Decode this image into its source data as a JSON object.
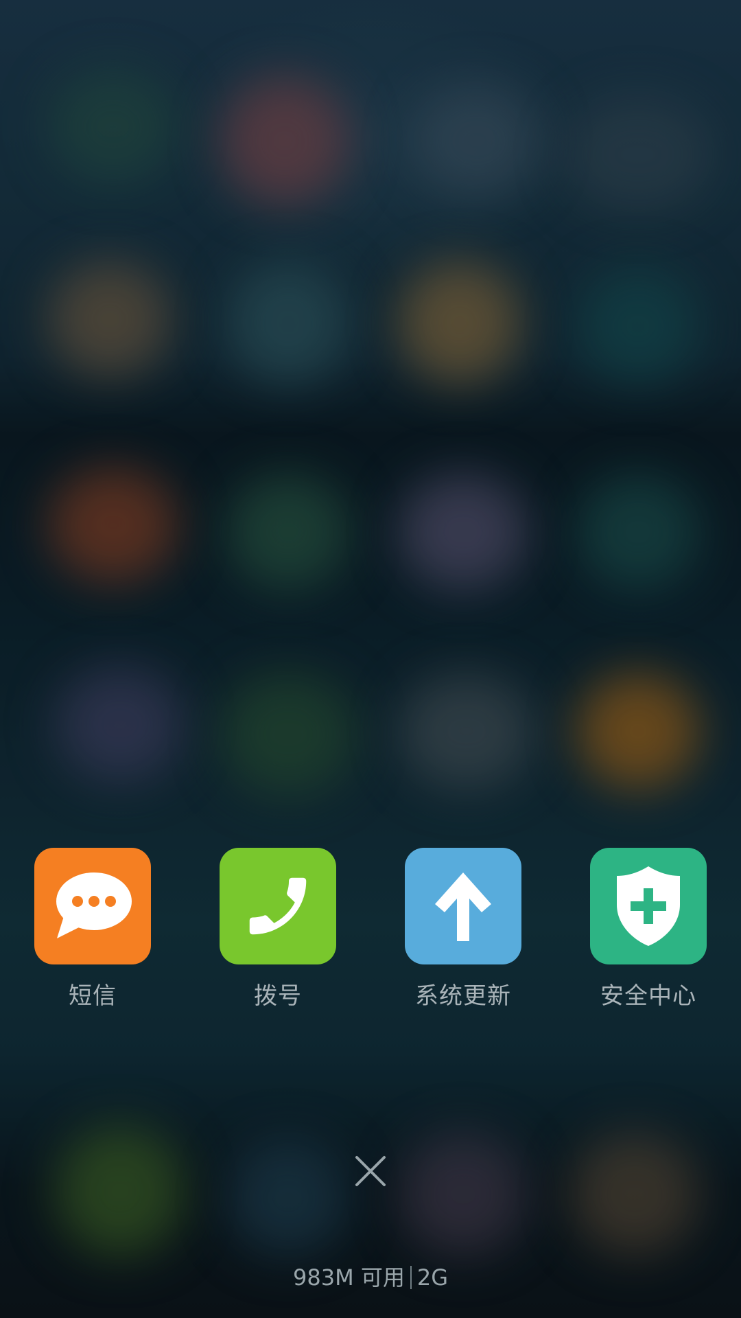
{
  "apps": [
    {
      "label": "短信",
      "icon": "message-bubble-icon",
      "color": "#f57f22"
    },
    {
      "label": "拨号",
      "icon": "phone-icon",
      "color": "#79c72d"
    },
    {
      "label": "系统更新",
      "icon": "arrow-up-icon",
      "color": "#58acdc"
    },
    {
      "label": "安全中心",
      "icon": "shield-plus-icon",
      "color": "#2db484"
    }
  ],
  "close": {
    "icon": "close-icon"
  },
  "memory": {
    "available": "983M 可用",
    "total": "2G"
  }
}
